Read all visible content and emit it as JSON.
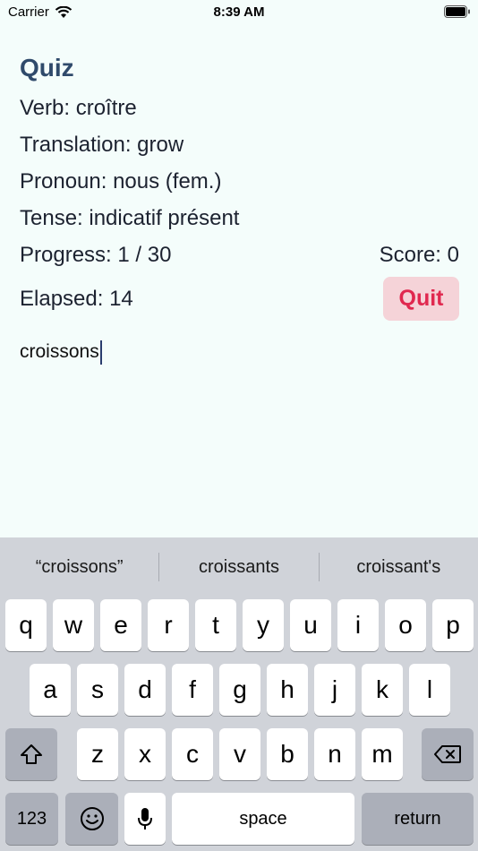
{
  "status": {
    "carrier": "Carrier",
    "time": "8:39 AM"
  },
  "quiz": {
    "title": "Quiz",
    "verb": "Verb: croître",
    "translation": "Translation: grow",
    "pronoun": "Pronoun: nous (fem.)",
    "tense": "Tense: indicatif présent",
    "progress": "Progress: 1 / 30",
    "score": "Score: 0",
    "elapsed": "Elapsed: 14",
    "quit_label": "Quit",
    "answer_value": "croissons"
  },
  "keyboard": {
    "suggestions": [
      "“croissons”",
      "croissants",
      "croissant's"
    ],
    "row1": [
      "q",
      "w",
      "e",
      "r",
      "t",
      "y",
      "u",
      "i",
      "o",
      "p"
    ],
    "row2": [
      "a",
      "s",
      "d",
      "f",
      "g",
      "h",
      "j",
      "k",
      "l"
    ],
    "row3": [
      "z",
      "x",
      "c",
      "v",
      "b",
      "n",
      "m"
    ],
    "numbers_label": "123",
    "space_label": "space",
    "return_label": "return",
    "icons": [
      "shift-icon",
      "backspace-icon",
      "emoji-icon",
      "microphone-icon"
    ]
  },
  "colors": {
    "background": "#f4fdfb",
    "title": "#2f4a6b",
    "quit_bg": "#f5d3d8",
    "quit_text": "#e0284f",
    "keyboard_bg": "#d0d3d9"
  }
}
